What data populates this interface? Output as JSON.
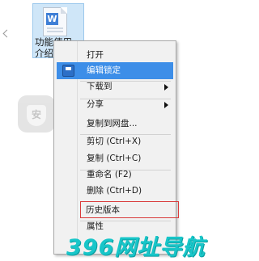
{
  "desktop": {
    "file": {
      "icon": "wps-document-icon",
      "badge_letter": "W",
      "label_line1": "功能使用",
      "label_line2": "介绍"
    }
  },
  "context_menu": {
    "items": [
      {
        "label": "打开",
        "state": "normal"
      },
      {
        "label": "编辑锁定",
        "state": "highlighted",
        "icon": "lock-document-icon"
      },
      {
        "label": "下载到",
        "state": "normal",
        "has_submenu": true
      },
      {
        "label": "分享",
        "state": "normal",
        "has_submenu": true
      },
      {
        "label": "复制到网盘...",
        "state": "normal"
      },
      {
        "label": "剪切 (Ctrl+X)",
        "state": "normal"
      },
      {
        "label": "复制 (Ctrl+C)",
        "state": "normal"
      },
      {
        "label": "重命名 (F2)",
        "state": "normal"
      },
      {
        "label": "删除 (Ctrl+D)",
        "state": "normal"
      },
      {
        "label": "历史版本",
        "state": "boxed"
      },
      {
        "label": "属性",
        "state": "normal"
      }
    ],
    "highlight_color": "#3d8ee8",
    "box_color": "#d93a3a"
  },
  "watermark": {
    "site": "396网址导航",
    "color": "#18c6c9",
    "logo_icon": "shield-watermark-icon"
  }
}
